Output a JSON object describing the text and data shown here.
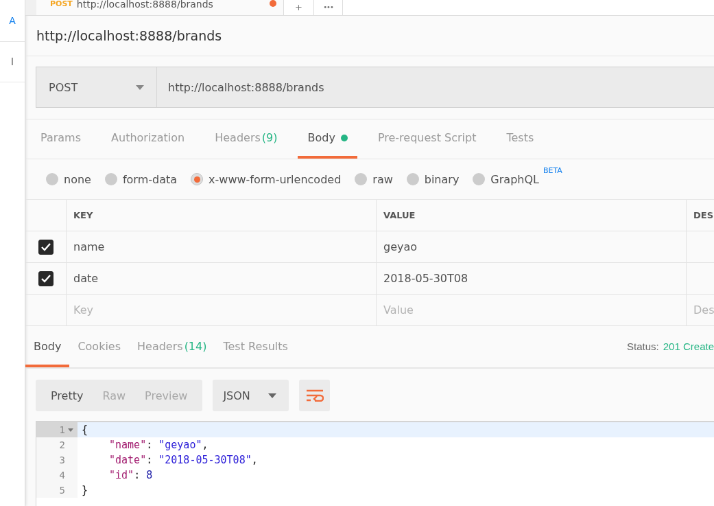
{
  "sidebar": {
    "items": [
      {
        "label": "A",
        "kind": "link"
      },
      {
        "label": "l",
        "kind": "text"
      }
    ]
  },
  "request_tabs": [
    {
      "method": "POST",
      "url": "http://localhost:8888/brands",
      "unsaved": true,
      "selected": true
    }
  ],
  "new_tab_button": "+",
  "more_button": "•••",
  "request_title": "http://localhost:8888/brands",
  "request": {
    "method": "POST",
    "url": "http://localhost:8888/brands"
  },
  "tabs": [
    {
      "label": "Params",
      "selected": false
    },
    {
      "label": "Authorization",
      "selected": false
    },
    {
      "label": "Headers",
      "count": "(9)",
      "selected": false
    },
    {
      "label": "Body",
      "dot": true,
      "selected": true
    },
    {
      "label": "Pre-request Script",
      "selected": false
    },
    {
      "label": "Tests",
      "selected": false
    }
  ],
  "body_types": [
    {
      "label": "none",
      "selected": false
    },
    {
      "label": "form-data",
      "selected": false
    },
    {
      "label": "x-www-form-urlencoded",
      "selected": true
    },
    {
      "label": "raw",
      "selected": false
    },
    {
      "label": "binary",
      "selected": false
    },
    {
      "label": "GraphQL",
      "badge": "BETA",
      "selected": false
    }
  ],
  "table": {
    "columns": [
      "KEY",
      "VALUE",
      "DES"
    ],
    "rows": [
      {
        "checked": true,
        "key": "name",
        "value": "geyao"
      },
      {
        "checked": true,
        "key": "date",
        "value": "2018-05-30T08"
      }
    ],
    "placeholder_row": {
      "key_placeholder": "Key",
      "value_placeholder": "Value",
      "description_placeholder": "Des"
    }
  },
  "response_tabs": [
    {
      "label": "Body",
      "selected": true
    },
    {
      "label": "Cookies",
      "selected": false
    },
    {
      "label": "Headers",
      "count": "(14)",
      "selected": false
    },
    {
      "label": "Test Results",
      "selected": false
    }
  ],
  "status": {
    "label": "Status:",
    "value": "201 Create"
  },
  "view_modes": [
    {
      "label": "Pretty",
      "selected": true
    },
    {
      "label": "Raw",
      "selected": false
    },
    {
      "label": "Preview",
      "selected": false
    }
  ],
  "format": "JSON",
  "code_lines": [
    {
      "number": "1",
      "fold": true,
      "active": true,
      "tokens": [
        {
          "kind": "punct",
          "text": "{"
        }
      ]
    },
    {
      "number": "2",
      "fold": false,
      "active": false,
      "tokens": [
        {
          "kind": "key",
          "text": "\"name\""
        },
        {
          "kind": "punct",
          "text": ": "
        },
        {
          "kind": "string",
          "text": "\"geyao\""
        },
        {
          "kind": "punct",
          "text": ","
        }
      ]
    },
    {
      "number": "3",
      "fold": false,
      "active": false,
      "tokens": [
        {
          "kind": "key",
          "text": "\"date\""
        },
        {
          "kind": "punct",
          "text": ": "
        },
        {
          "kind": "string",
          "text": "\"2018-05-30T08\""
        },
        {
          "kind": "punct",
          "text": ","
        }
      ]
    },
    {
      "number": "4",
      "fold": false,
      "active": false,
      "tokens": [
        {
          "kind": "key",
          "text": "\"id\""
        },
        {
          "kind": "punct",
          "text": ": "
        },
        {
          "kind": "number",
          "text": "8"
        }
      ]
    },
    {
      "number": "5",
      "fold": false,
      "active": false,
      "tokens": [
        {
          "kind": "punct",
          "text": "}"
        }
      ]
    }
  ]
}
